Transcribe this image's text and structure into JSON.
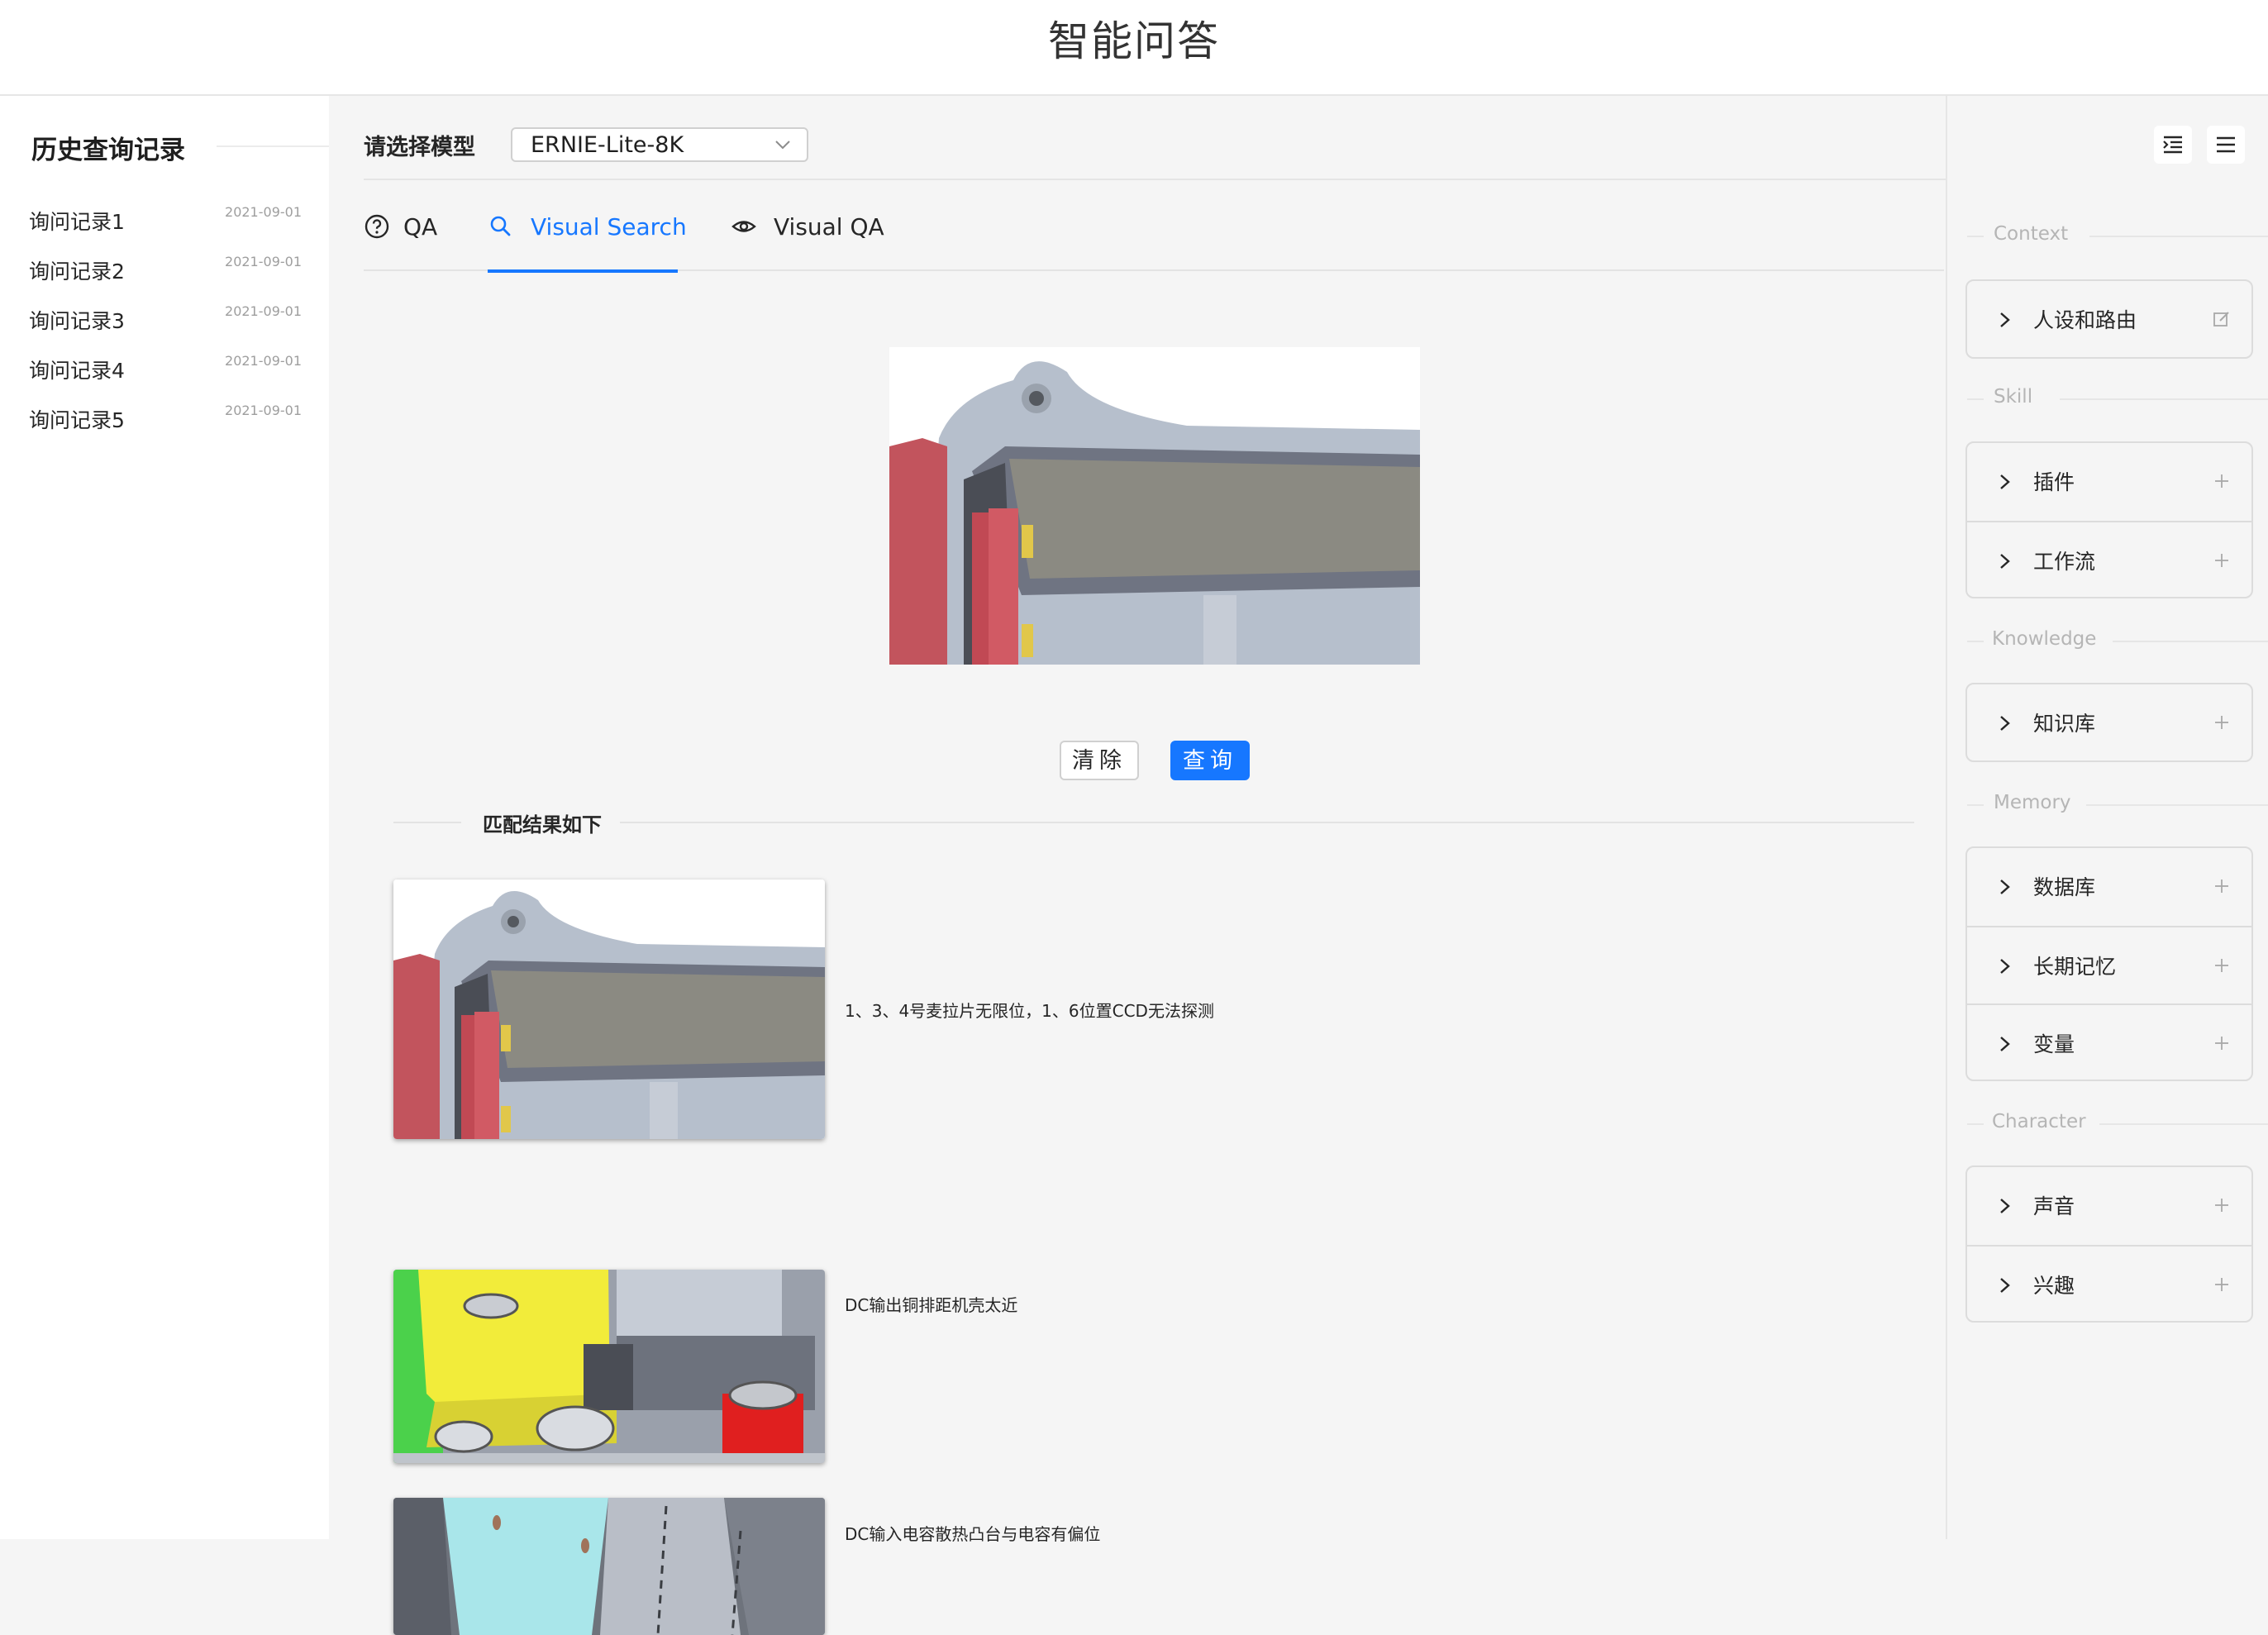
{
  "app": {
    "title": "智能问答"
  },
  "sidebar": {
    "title": "历史查询记录",
    "items": [
      {
        "label": "询问记录1",
        "date": "2021-09-01"
      },
      {
        "label": "询问记录2",
        "date": "2021-09-01"
      },
      {
        "label": "询问记录3",
        "date": "2021-09-01"
      },
      {
        "label": "询问记录4",
        "date": "2021-09-01"
      },
      {
        "label": "询问记录5",
        "date": "2021-09-01"
      }
    ]
  },
  "model": {
    "label": "请选择模型",
    "selected": "ERNIE-Lite-8K"
  },
  "tabs": [
    {
      "label": "QA",
      "icon": "question-circle-icon",
      "active": false
    },
    {
      "label": "Visual Search",
      "icon": "search-icon",
      "active": true
    },
    {
      "label": "Visual QA",
      "icon": "eye-icon",
      "active": false
    }
  ],
  "actions": {
    "clear": "清除",
    "query": "查询"
  },
  "results": {
    "heading": "匹配结果如下",
    "items": [
      {
        "text": "1、3、4号麦拉片无限位，1、6位置CCD无法探测"
      },
      {
        "text": "DC输出铜排距机壳太近"
      },
      {
        "text": "DC输入电容散热凸台与电容有偏位"
      }
    ]
  },
  "right_panel": {
    "sections": [
      {
        "title": "Context",
        "items": [
          {
            "label": "人设和路由",
            "action": "edit-icon"
          }
        ]
      },
      {
        "title": "Skill",
        "items": [
          {
            "label": "插件",
            "action": "plus-icon"
          },
          {
            "label": "工作流",
            "action": "plus-icon"
          }
        ]
      },
      {
        "title": "Knowledge",
        "items": [
          {
            "label": "知识库",
            "action": "plus-icon"
          }
        ]
      },
      {
        "title": "Memory",
        "items": [
          {
            "label": "数据库",
            "action": "plus-icon"
          },
          {
            "label": "长期记忆",
            "action": "plus-icon"
          },
          {
            "label": "变量",
            "action": "plus-icon"
          }
        ]
      },
      {
        "title": "Character",
        "items": [
          {
            "label": "声音",
            "action": "plus-icon"
          },
          {
            "label": "兴趣",
            "action": "plus-icon"
          }
        ]
      }
    ]
  },
  "colors": {
    "accent": "#1677ff",
    "background": "#f5f5f5"
  }
}
